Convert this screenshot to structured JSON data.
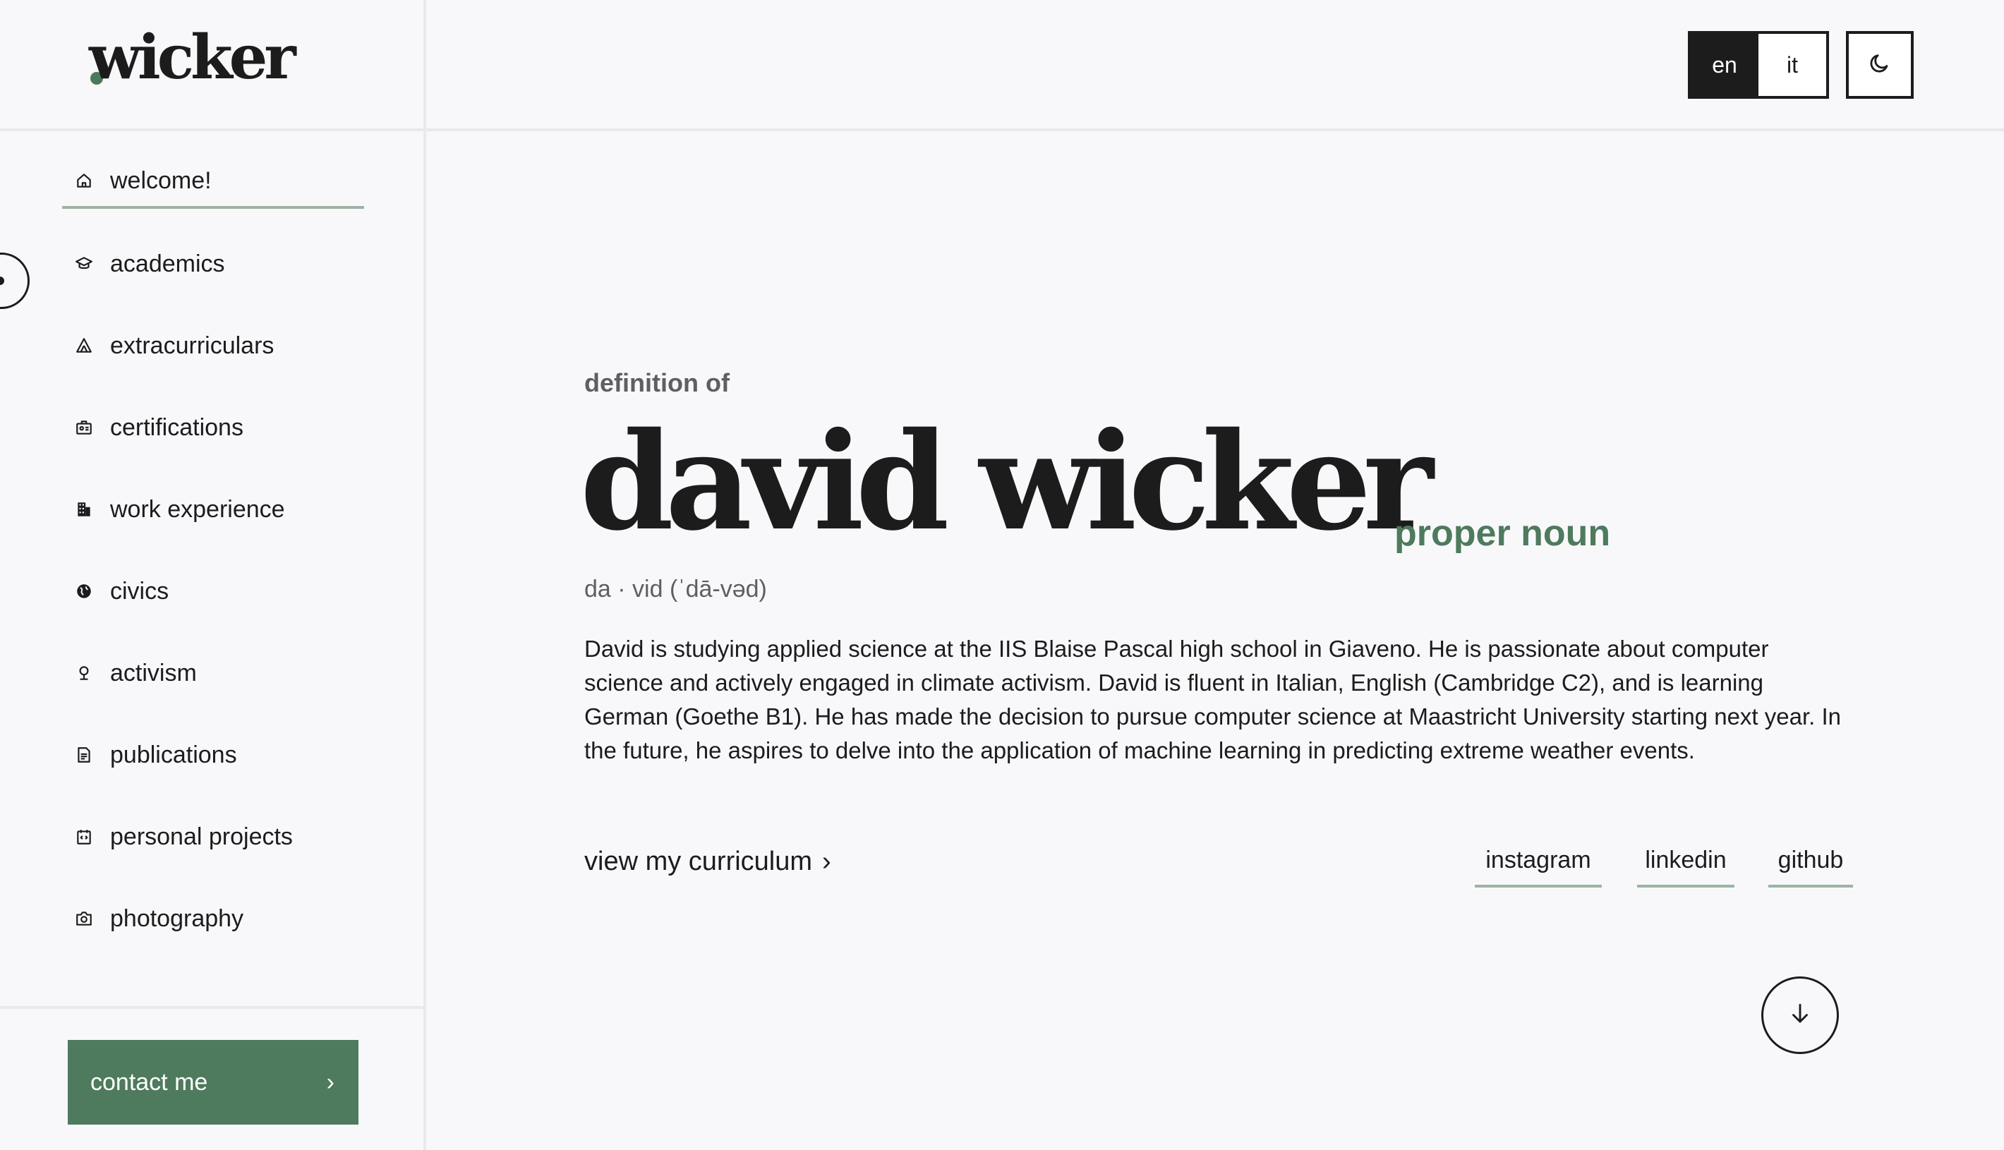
{
  "sidebar": {
    "logo": "wicker",
    "items": [
      {
        "label": "welcome!",
        "icon": "home-icon"
      },
      {
        "label": "academics",
        "icon": "graduation-cap-icon"
      },
      {
        "label": "extracurriculars",
        "icon": "tent-icon"
      },
      {
        "label": "certifications",
        "icon": "badge-icon"
      },
      {
        "label": "work experience",
        "icon": "building-icon"
      },
      {
        "label": "civics",
        "icon": "globe-icon"
      },
      {
        "label": "activism",
        "icon": "tree-icon"
      },
      {
        "label": "publications",
        "icon": "document-icon"
      },
      {
        "label": "personal projects",
        "icon": "code-icon"
      },
      {
        "label": "photography",
        "icon": "camera-icon"
      }
    ],
    "active_item": "welcome!",
    "contact_label": "contact me",
    "contact_chevron": "›"
  },
  "header": {
    "lang_en": "en",
    "lang_it": "it",
    "active_lang": "en",
    "theme_icon": "moon-icon"
  },
  "main": {
    "definition_of": "definition of",
    "name": "david wicker",
    "part_of_speech": "proper noun",
    "pronunciation": "da · vid (ˈdā-vəd)",
    "description": "David is studying applied science at the IIS Blaise Pascal high school in Giaveno. He is passionate about computer science and actively engaged in climate activism. David is fluent in Italian, English (Cambridge C2), and is learning German (Goethe B1). He has made the decision to pursue computer science at Maastricht University starting next year. In the future, he aspires to delve into the application of machine learning in predicting extreme weather events.",
    "cv_link": "view my curriculum",
    "cv_chevron": "›",
    "socials": {
      "instagram": "instagram",
      "linkedin": "linkedin",
      "github": "github"
    },
    "scroll_icon": "arrow-down-icon"
  },
  "colors": {
    "accent": "#4e7a5d",
    "accent_light": "#9cb3a4",
    "text": "#1c1c1c",
    "muted": "#5f5f5f",
    "background": "#f8f8fb"
  }
}
